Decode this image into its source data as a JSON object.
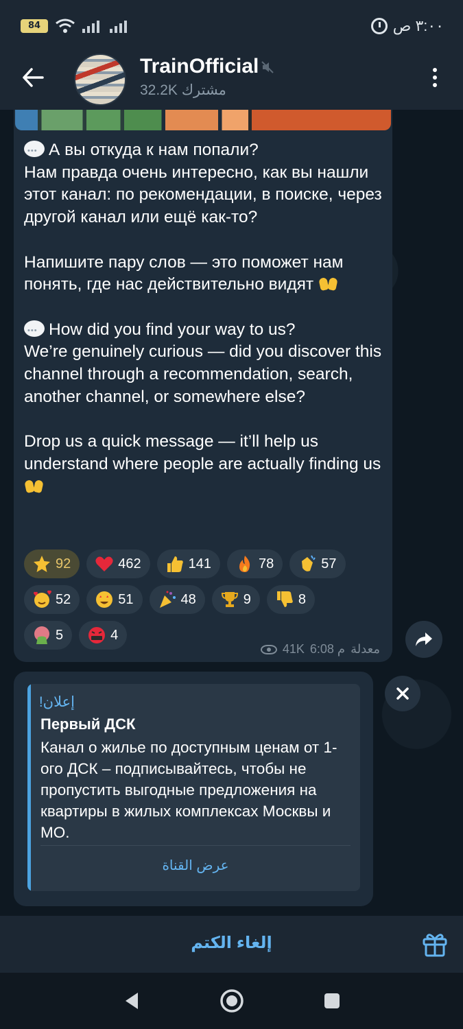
{
  "status_bar": {
    "battery": "84",
    "time": "٣:٠٠ ص"
  },
  "header": {
    "channel_name": "TrainOfficial",
    "subscribers": "32.2K مشترك"
  },
  "message": {
    "paragraphs": [
      "А вы откуда к нам попали?\nНам правда очень интересно, как вы нашли этот канал: по рекомендации, в поиске, через другой канал или ещё как-то?",
      "Напишите пару слов — это поможет нам понять, где нас действительно видят",
      "How did you find your way to us?\nWe’re genuinely curious — did you discover this channel through a recommendation, search, another channel, or somewhere else?",
      "Drop us a quick message — it’ll help us understand where people are actually finding us"
    ],
    "reactions": [
      {
        "icon": "star-icon",
        "count": "92",
        "color": "#f5c033",
        "active": true
      },
      {
        "icon": "heart-icon",
        "count": "462",
        "color": "#e5283a"
      },
      {
        "icon": "thumbs-up-icon",
        "count": "141",
        "color": "#f5c033"
      },
      {
        "icon": "fire-icon",
        "count": "78",
        "color": "#f47a1e"
      },
      {
        "icon": "clap-icon",
        "count": "57",
        "color": "#f5c033"
      },
      {
        "icon": "smiling-hearts-icon",
        "count": "52",
        "color": "#f5c033"
      },
      {
        "icon": "star-struck-icon",
        "count": "51",
        "color": "#f5c033"
      },
      {
        "icon": "party-popper-icon",
        "count": "48",
        "color": "#9b59b6"
      },
      {
        "icon": "trophy-icon",
        "count": "9",
        "color": "#e6a91e"
      },
      {
        "icon": "thumbs-down-icon",
        "count": "8",
        "color": "#f5c033"
      },
      {
        "icon": "vomit-icon",
        "count": "5",
        "color": "#6ab04c"
      },
      {
        "icon": "cursing-icon",
        "count": "4",
        "color": "#e5283a"
      }
    ],
    "views": "41K",
    "time": "6:08 م",
    "edited": "معدلة"
  },
  "ad": {
    "label": "إعلان!",
    "title": "Первый ДСК",
    "text": "Канал о жилье по доступным ценам от 1-ого ДСК – подписывайтесь, чтобы не пропустить выгодные предложения на квартиры в жилых комплексах Москвы и МО.",
    "link": "عرض القناة"
  },
  "bottom": {
    "unmute": "إلغاء الكتم"
  }
}
